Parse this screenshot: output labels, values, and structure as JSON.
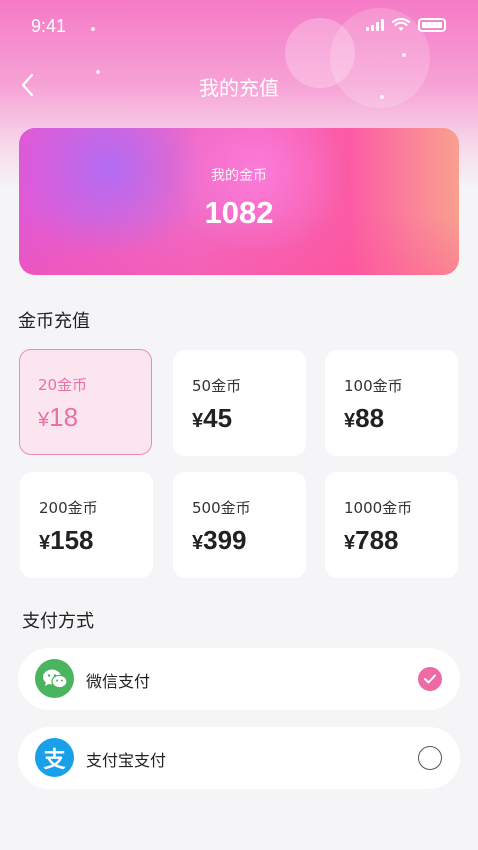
{
  "status_bar": {
    "time": "9:41"
  },
  "nav": {
    "title": "我的充值"
  },
  "balance": {
    "label": "我的金币",
    "value": "1082"
  },
  "recharge": {
    "title": "金币充值",
    "packages": [
      {
        "coins": "20金币",
        "currency": "¥",
        "price": "18",
        "selected": true
      },
      {
        "coins": "50金币",
        "currency": "¥",
        "price": "45",
        "selected": false
      },
      {
        "coins": "100金币",
        "currency": "¥",
        "price": "88",
        "selected": false
      },
      {
        "coins": "200金币",
        "currency": "¥",
        "price": "158",
        "selected": false
      },
      {
        "coins": "500金币",
        "currency": "¥",
        "price": "399",
        "selected": false
      },
      {
        "coins": "1000金币",
        "currency": "¥",
        "price": "788",
        "selected": false
      }
    ]
  },
  "payment": {
    "title": "支付方式",
    "methods": [
      {
        "label": "微信支付",
        "icon": "wechat-icon",
        "checked": true
      },
      {
        "label": "支付宝支付",
        "icon": "alipay-icon",
        "icon_char": "支",
        "checked": false
      }
    ]
  },
  "colors": {
    "accent": "#ee6aa4",
    "wechat": "#4bb45f",
    "alipay": "#1aa0e8"
  }
}
